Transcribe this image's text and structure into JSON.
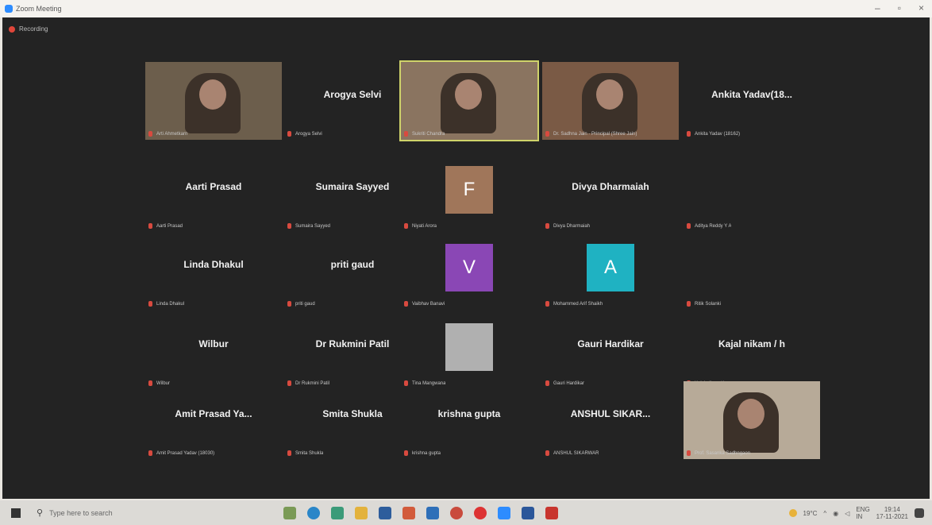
{
  "window": {
    "title": "Zoom Meeting",
    "recording": "Recording"
  },
  "tiles": [
    {
      "label": "Arti Ahmetkarn",
      "type": "video"
    },
    {
      "name": "Arogya Selvi",
      "label": "Arogya Selvi"
    },
    {
      "label": "Sukriti Chandra",
      "type": "video",
      "active": true
    },
    {
      "label": "Dr. Sadhna Jain - Principal (Shree Jain)",
      "type": "video"
    },
    {
      "name": "Ankita Yadav(18...",
      "label": "Ankita Yadav (18162)"
    },
    {
      "name": "Aarti Prasad",
      "label": "Aarti Prasad"
    },
    {
      "name": "Sumaira Sayyed",
      "label": "Sumaira Sayyed"
    },
    {
      "avatar": "F",
      "avatar_color": "#a0765a",
      "label": "Niyati Arora"
    },
    {
      "name": "Divya Dharmaiah",
      "label": "Divya Dharmaiah"
    },
    {
      "label": "Aditya Reddy Y A"
    },
    {
      "name": "Linda Dhakul",
      "label": "Linda Dhakul"
    },
    {
      "name": "priti gaud",
      "label": "priti gaud"
    },
    {
      "avatar": "V",
      "avatar_color": "#8a47b5",
      "label": "Vaibhav Banavi"
    },
    {
      "avatar": "A",
      "avatar_color": "#1fb2c2",
      "label": "Mohammed Arif Shaikh"
    },
    {
      "label": "Ritik Solanki"
    },
    {
      "name": "Wilbur",
      "label": "Wilbur"
    },
    {
      "name": "Dr Rukmini Patil",
      "label": "Dr Rukmini Patil"
    },
    {
      "photo": true,
      "label": "Tina Mangwana"
    },
    {
      "name": "Gauri Hardikar",
      "label": "Gauri Hardikar"
    },
    {
      "name": "Kajal nikam / h",
      "label": "Kajal nikam / h"
    },
    {
      "name": "Amit Prasad Ya...",
      "label": "Amit Prasad Yadav (18030)"
    },
    {
      "name": "Smita Shukla",
      "label": "Smita Shukla"
    },
    {
      "name": "krishna gupta",
      "label": "krishna gupta"
    },
    {
      "name": "ANSHUL SIKAR...",
      "label": "ANSHUL SIKARWAR"
    },
    {
      "label": "Prof. Sasanka Sadhngaon",
      "type": "video"
    }
  ],
  "taskbar": {
    "search_placeholder": "Type here to search",
    "weather": "19°C",
    "lang": "ENG",
    "region": "IN",
    "time": "19:14",
    "date": "17-11-2021"
  }
}
